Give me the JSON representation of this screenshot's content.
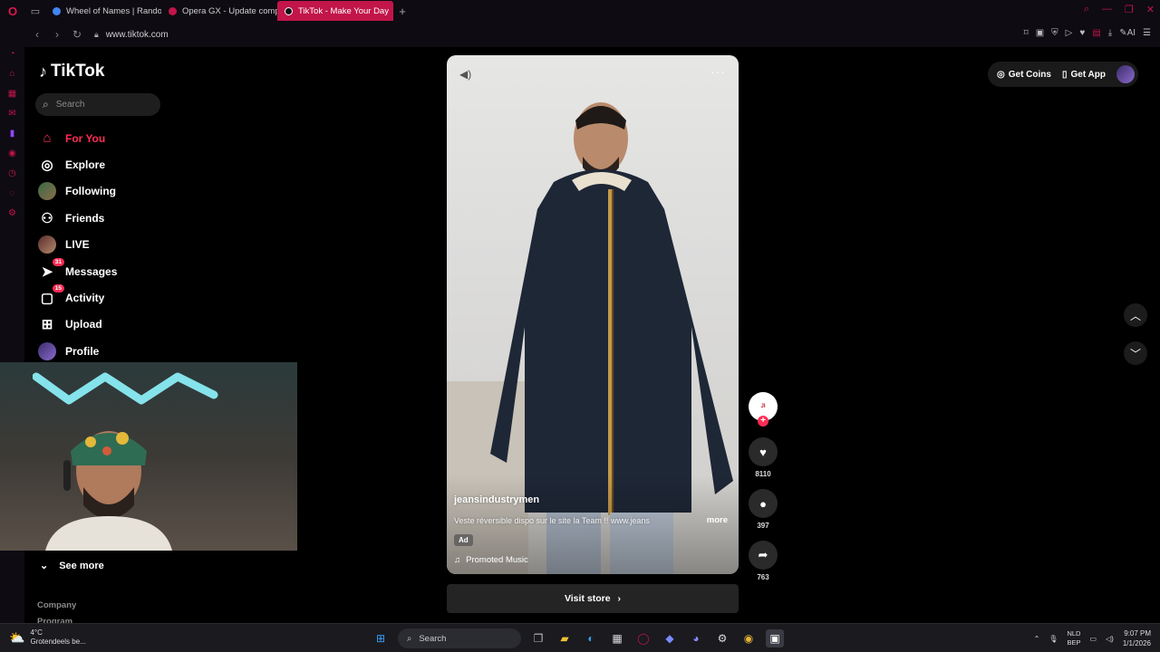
{
  "browser": {
    "tabs": [
      {
        "label": "Wheel of Names | Random",
        "color": "#4285f4"
      },
      {
        "label": "Opera GX - Update comp",
        "color": "#c2154a"
      },
      {
        "label": "TikTok - Make Your Day",
        "color": "#111111"
      }
    ],
    "url": "www.tiktok.com",
    "ai_label": "AI"
  },
  "tiktok": {
    "logo": "TikTok",
    "search_placeholder": "Search",
    "nav": [
      {
        "label": "For You",
        "icon": "home-icon"
      },
      {
        "label": "Explore",
        "icon": "compass-icon"
      },
      {
        "label": "Following",
        "icon": "following-avatar-icon"
      },
      {
        "label": "Friends",
        "icon": "friends-icon"
      },
      {
        "label": "LIVE",
        "icon": "live-avatar-icon"
      },
      {
        "label": "Messages",
        "icon": "messages-icon",
        "badge": "31"
      },
      {
        "label": "Activity",
        "icon": "activity-icon",
        "badge": "15"
      },
      {
        "label": "Upload",
        "icon": "upload-icon"
      },
      {
        "label": "Profile",
        "icon": "profile-avatar-icon"
      }
    ],
    "see_more": "See more",
    "footer": [
      "Company",
      "Program"
    ],
    "header": {
      "get_coins": "Get Coins",
      "get_app": "Get App"
    },
    "video": {
      "username": "jeansindustrymen",
      "description": "Veste réversible dispo sur le site la Team !! www.jeans",
      "more": "more",
      "ad": "Ad",
      "music": "Promoted Music",
      "visit_store": "Visit store"
    },
    "actions": {
      "likes": "8110",
      "comments": "397",
      "shares": "763"
    }
  },
  "taskbar": {
    "temp": "4°C",
    "weather": "Grotendeels be...",
    "search": "Search",
    "lang": [
      "NLD",
      "BEP"
    ],
    "time": "9:07 PM",
    "date": "1/1/2026"
  }
}
